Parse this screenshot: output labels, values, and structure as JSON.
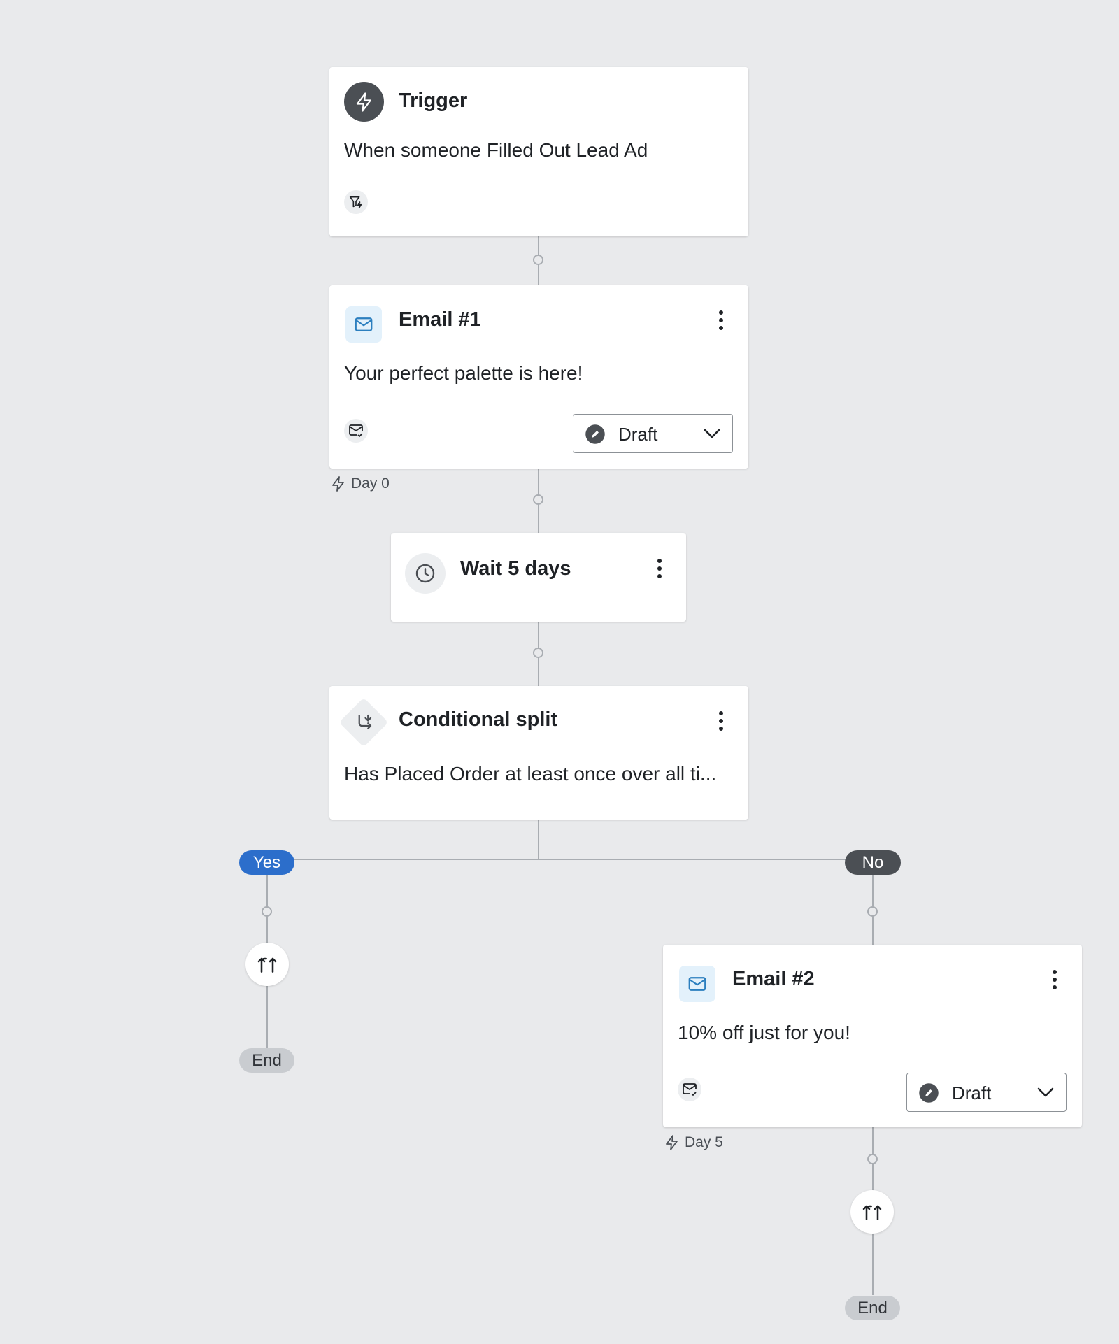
{
  "trigger": {
    "title": "Trigger",
    "description": "When someone Filled Out Lead Ad",
    "icon": "lightning-icon",
    "filter_icon": "filter-lightning-icon"
  },
  "email1": {
    "title": "Email #1",
    "subject": "Your perfect palette is here!",
    "status": "Draft",
    "day": "Day 0",
    "icon": "envelope-icon"
  },
  "wait": {
    "title": "Wait 5 days",
    "icon": "clock-icon"
  },
  "split": {
    "title": "Conditional split",
    "condition": "Has Placed Order at least once over all ti...",
    "icon": "split-icon"
  },
  "branches": {
    "yes_label": "Yes",
    "no_label": "No"
  },
  "email2": {
    "title": "Email #2",
    "subject": "10% off just for you!",
    "status": "Draft",
    "day": "Day 5",
    "icon": "envelope-icon"
  },
  "end_labels": {
    "yes_end": "End",
    "no_end": "End"
  },
  "colors": {
    "background": "#e9eaec",
    "yes_pill": "#2c6ecb",
    "no_pill": "#4b4f54",
    "email_icon_bg": "#e3f1fb",
    "email_icon": "#2c7fbf"
  }
}
